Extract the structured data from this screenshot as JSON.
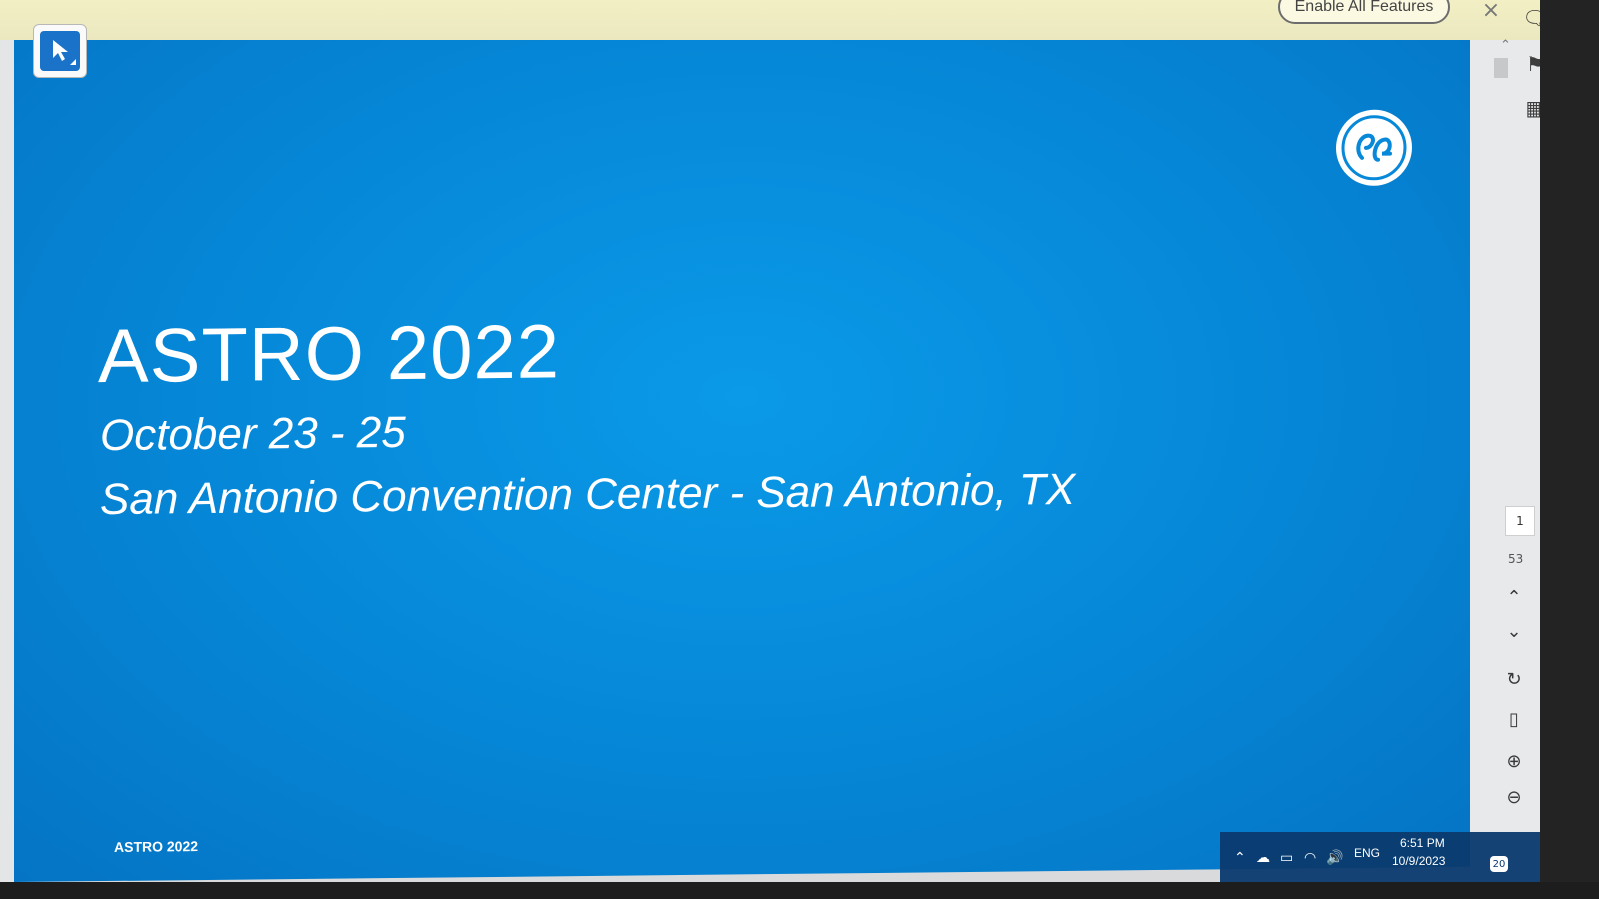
{
  "notification": {
    "button_label": "Enable All Features",
    "close_icon": "×"
  },
  "slide": {
    "title": "ASTRO 2022",
    "dates": "October 23 - 25",
    "venue": "San Antonio Convention Center - San Antonio, TX",
    "footer": "ASTRO 2022",
    "background_color": "#0788d8",
    "logo": "GE"
  },
  "navigation": {
    "current_page": "1",
    "total_pages": "53"
  },
  "taskbar": {
    "language": "ENG",
    "time": "6:51 PM",
    "date": "10/9/2023",
    "notification_count": "20"
  }
}
